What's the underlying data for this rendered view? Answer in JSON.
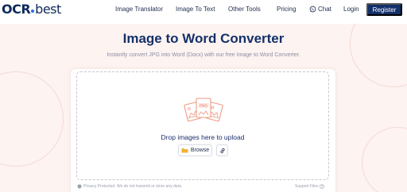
{
  "nav": {
    "logo_prefix": "OCR",
    "logo_suffix": "best",
    "links": {
      "image_translator": "Image Translator",
      "image_to_text": "Image To Text",
      "other_tools": "Other Tools",
      "pricing": "Pricing",
      "chat": "Chat",
      "login": "Login"
    },
    "register": "Register"
  },
  "hero": {
    "title": "Image to Word Converter",
    "subtitle": "Instantly convert JPG into Word (Docx) with our free Image to Word Converter."
  },
  "upload": {
    "drop_text": "Drop images here to upload",
    "browse_label": "Browse",
    "art_label": "PNG"
  },
  "footer": {
    "privacy_text": "Privacy Protected. We do not transmit or store any data.",
    "support_text": "Support Files"
  },
  "colors": {
    "brand_navy": "#13306b",
    "hero_bg": "#fdf3f1",
    "accent_salmon": "#ef9a85",
    "folder_yellow": "#f2b233"
  }
}
